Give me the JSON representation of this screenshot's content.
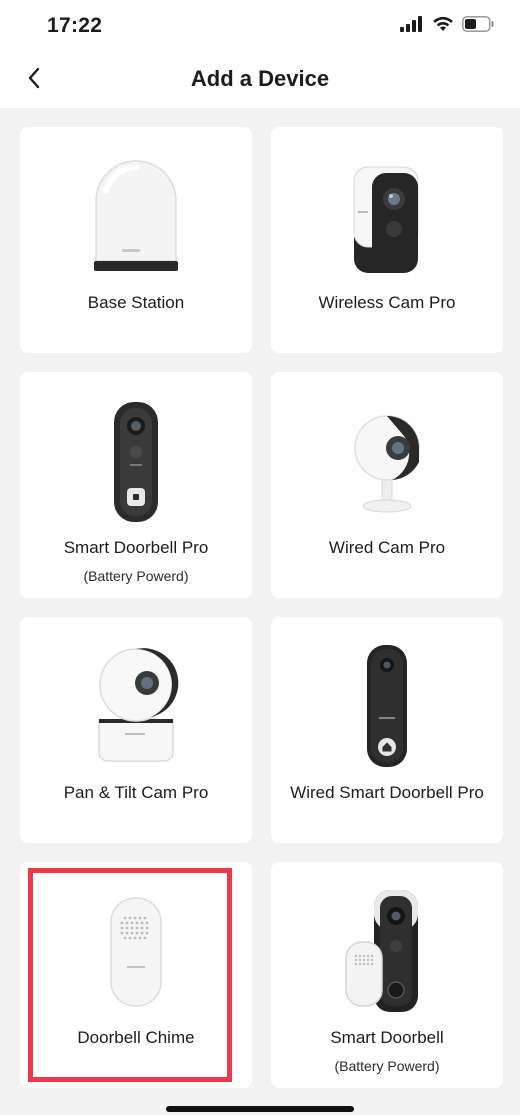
{
  "status_bar": {
    "time": "17:22",
    "icons": [
      "cellular-signal-icon",
      "wifi-icon",
      "battery-icon"
    ]
  },
  "nav": {
    "title": "Add a Device",
    "back_icon": "chevron-left-icon"
  },
  "devices": [
    {
      "label": "Base Station",
      "sub": "",
      "icon": "base-station-icon"
    },
    {
      "label": "Wireless Cam Pro",
      "sub": "",
      "icon": "wireless-cam-icon"
    },
    {
      "label": "Smart Doorbell Pro",
      "sub": "(Battery Powerd)",
      "icon": "doorbell-pro-icon"
    },
    {
      "label": "Wired Cam Pro",
      "sub": "",
      "icon": "wired-cam-icon"
    },
    {
      "label": "Pan & Tilt Cam Pro",
      "sub": "",
      "icon": "pan-tilt-cam-icon"
    },
    {
      "label": "Wired Smart Doorbell Pro",
      "sub": "",
      "icon": "wired-doorbell-icon"
    },
    {
      "label": "Doorbell Chime",
      "sub": "",
      "icon": "chime-icon",
      "highlighted": true
    },
    {
      "label": "Smart Doorbell",
      "sub": "(Battery Powerd)",
      "icon": "smart-doorbell-icon"
    }
  ],
  "colors": {
    "background": "#f2f2f3",
    "card": "#ffffff",
    "highlight": "#ec3b46"
  }
}
